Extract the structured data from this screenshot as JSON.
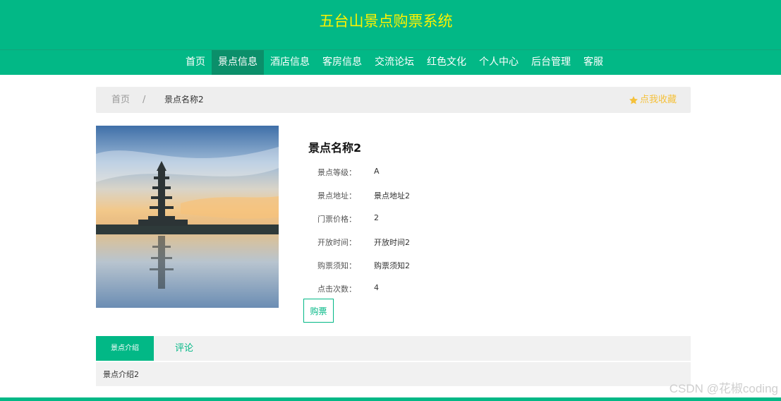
{
  "header": {
    "title": "五台山景点购票系统"
  },
  "nav": {
    "items": [
      {
        "label": "首页",
        "active": false
      },
      {
        "label": "景点信息",
        "active": true
      },
      {
        "label": "酒店信息",
        "active": false
      },
      {
        "label": "客房信息",
        "active": false
      },
      {
        "label": "交流论坛",
        "active": false
      },
      {
        "label": "红色文化",
        "active": false
      },
      {
        "label": "个人中心",
        "active": false
      },
      {
        "label": "后台管理",
        "active": false
      },
      {
        "label": "客服",
        "active": false
      }
    ]
  },
  "breadcrumb": {
    "home": "首页",
    "separator": "/",
    "current": "景点名称2"
  },
  "favorite": {
    "label": "点我收藏",
    "icon": "star-icon",
    "color": "#f5c13b"
  },
  "spot": {
    "name": "景点名称2",
    "fields": [
      {
        "label": "景点等级：",
        "value": "A"
      },
      {
        "label": "景点地址：",
        "value": "景点地址2"
      },
      {
        "label": "门票价格：",
        "value": "2"
      },
      {
        "label": "开放时间：",
        "value": "开放时间2"
      },
      {
        "label": "购票须知：",
        "value": "购票须知2"
      },
      {
        "label": "点击次数：",
        "value": "4"
      }
    ]
  },
  "buy_button": {
    "label": "购票"
  },
  "tabs": {
    "items": [
      {
        "label": "景点介绍",
        "active": true
      },
      {
        "label": "评论",
        "active": false
      }
    ],
    "content": "景点介绍2"
  },
  "watermark": "CSDN @花椒coding",
  "colors": {
    "brand": "#02b886",
    "title": "#fff200",
    "nav_active": "#0b8f6a"
  }
}
